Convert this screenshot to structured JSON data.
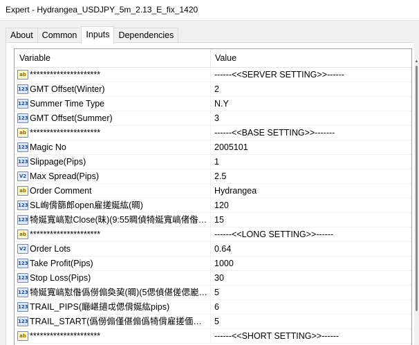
{
  "window": {
    "title": "Expert - Hydrangea_USDJPY_5m_2.13_E_fix_1420"
  },
  "tabs": [
    {
      "label": "About",
      "active": false
    },
    {
      "label": "Common",
      "active": false
    },
    {
      "label": "Inputs",
      "active": true
    },
    {
      "label": "Dependencies",
      "active": false
    }
  ],
  "grid": {
    "header_variable": "Variable",
    "header_value": "Value",
    "rows": [
      {
        "icon": "ab",
        "variable": "*********************",
        "value": "------<<SERVER SETTING>>------"
      },
      {
        "icon": "123",
        "variable": "GMT Offset(Winter)",
        "value": "2"
      },
      {
        "icon": "123",
        "variable": "Summer Time Type",
        "value": "N.Y"
      },
      {
        "icon": "123",
        "variable": "GMT Offset(Summer)",
        "value": "3"
      },
      {
        "icon": "ab",
        "variable": "*********************",
        "value": "------<<BASE SETTING>>-------"
      },
      {
        "icon": "123",
        "variable": "Magic No",
        "value": "2005101"
      },
      {
        "icon": "123",
        "variable": "Slippage(Pips)",
        "value": "1"
      },
      {
        "icon": "v2",
        "variable": "Max Spread(Pips)",
        "value": "2.5"
      },
      {
        "icon": "ab",
        "variable": "Order Comment",
        "value": "Hydrangea"
      },
      {
        "icon": "123",
        "variable": "SL峋偝篩郎open雇搓娫紘(晭)",
        "value": "120"
      },
      {
        "icon": "123",
        "variable": "犄娫寬嵪懟Close(昧)(9:55晭偵犄娫寬嵪偖偺偡...",
        "value": "15"
      },
      {
        "icon": "ab",
        "variable": "*********************",
        "value": "------<<LONG SETTING>>------"
      },
      {
        "icon": "v2",
        "variable": "Order Lots",
        "value": "0.64"
      },
      {
        "icon": "123",
        "variable": "Take Profit(Pips)",
        "value": "1000"
      },
      {
        "icon": "123",
        "variable": "Stop Loss(Pips)",
        "value": "30"
      },
      {
        "icon": "123",
        "variable": "犄娫寬嵪懟偺僞僗傓奐巭(晭)(5偲偵偡傞偲嶏偵?...",
        "value": "5"
      },
      {
        "icon": "123",
        "variable": "TRAIL_PIPS(廰嵁擿戉偲偝娫紘pips)",
        "value": "6"
      },
      {
        "icon": "123",
        "variable": "TRAIL_START(僞僗傓僅偡傓僞犄偝雇搓偭偺?...",
        "value": "5"
      },
      {
        "icon": "ab",
        "variable": "*********************",
        "value": "------<<SHORT SETTING>>------"
      }
    ]
  },
  "icons": {
    "ab": "string-type-icon",
    "123": "integer-type-icon",
    "v2": "double-type-icon"
  },
  "icon_glyphs": {
    "ab": "ab",
    "123": "123",
    "v2": "V2"
  }
}
